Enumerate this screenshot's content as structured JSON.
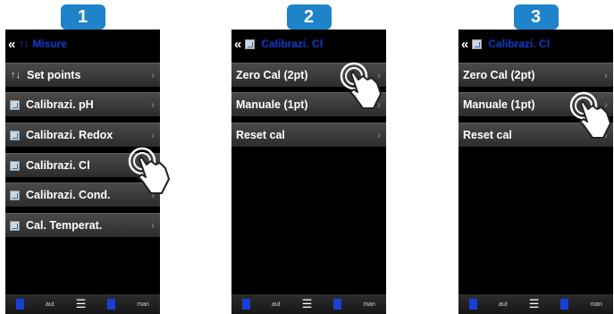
{
  "steps": [
    "1",
    "2",
    "3"
  ],
  "screen1": {
    "title": "Misure",
    "items": [
      {
        "icon": "↑↓",
        "label": "Set points"
      },
      {
        "icon": "cal",
        "label": "Calibrazi. pH"
      },
      {
        "icon": "cal",
        "label": "Calibrazi. Redox"
      },
      {
        "icon": "cal",
        "label": "Calibrazi. Cl"
      },
      {
        "icon": "cal",
        "label": "Calibrazi. Cond."
      },
      {
        "icon": "cal",
        "label": "Cal. Temperat."
      }
    ]
  },
  "screen2": {
    "title": "Calibrazi. Cl",
    "items": [
      {
        "label": "Zero Cal (2pt)"
      },
      {
        "label": "Manuale (1pt)"
      },
      {
        "label": "Reset cal"
      }
    ]
  },
  "screen3": {
    "title": "Calibrazi. Cl",
    "items": [
      {
        "label": "Zero Cal (2pt)"
      },
      {
        "label": "Manuale (1pt)"
      },
      {
        "label": "Reset cal"
      }
    ]
  },
  "bottom_bar": {
    "left_label": "aut",
    "right_label": "man"
  },
  "colors": {
    "badge": "#1e83c8",
    "title_text": "#1a3fd6",
    "screen_bg": "#000000"
  }
}
